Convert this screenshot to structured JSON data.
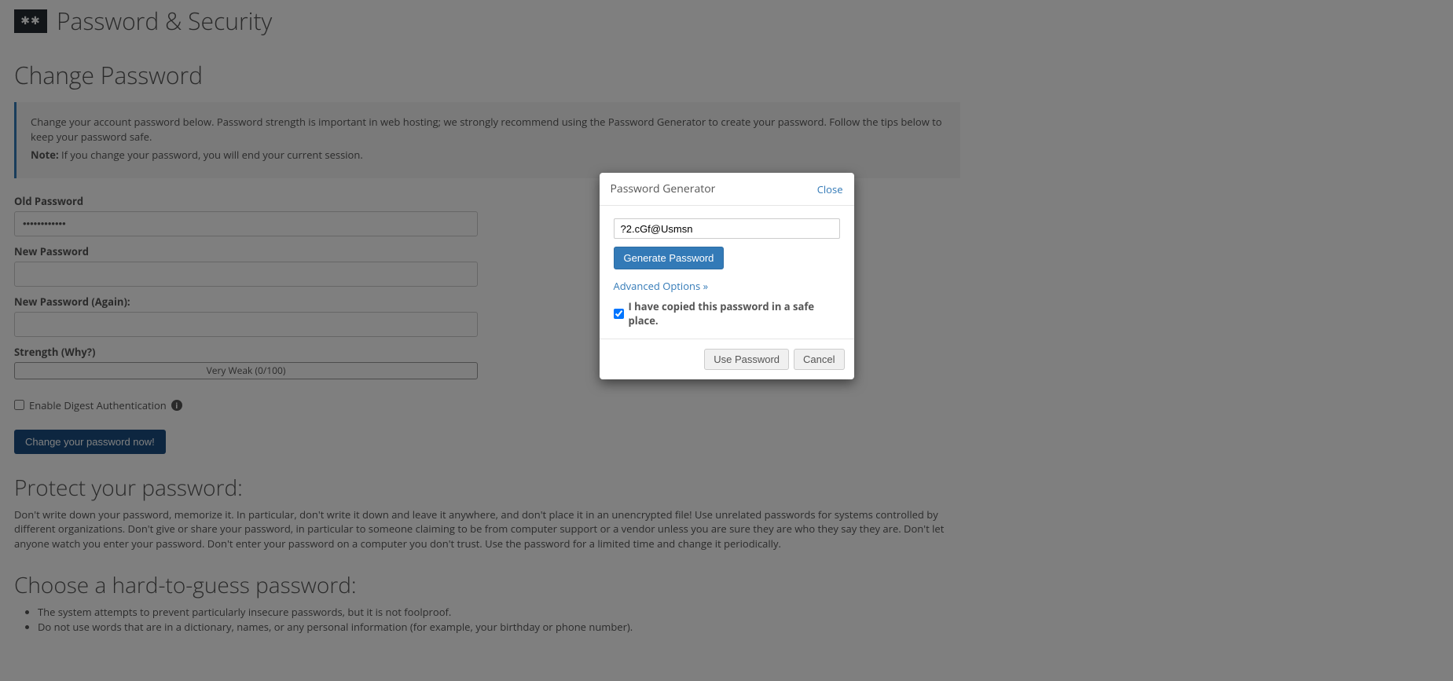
{
  "header": {
    "icon_glyph": "✱✱",
    "title": "Password & Security"
  },
  "change_password": {
    "heading": "Change Password",
    "info_text": "Change your account password below. Password strength is important in web hosting; we strongly recommend using the Password Generator to create your password. Follow the tips below to keep your password safe.",
    "note_label": "Note:",
    "note_text": " If you change your password, you will end your current session.",
    "fields": {
      "old_password_label": "Old Password",
      "old_password_value": "••••••••••••",
      "new_password_label": "New Password",
      "new_password_value": "",
      "new_password_again_label": "New Password (Again):",
      "new_password_again_value": "",
      "strength_label": "Strength (Why?)",
      "strength_text": "Very Weak (0/100)"
    },
    "digest_label": "Enable Digest Authentication",
    "submit_label": "Change your password now!"
  },
  "protect": {
    "heading": "Protect your password:",
    "text": "Don't write down your password, memorize it. In particular, don't write it down and leave it anywhere, and don't place it in an unencrypted file! Use unrelated passwords for systems controlled by different organizations. Don't give or share your password, in particular to someone claiming to be from computer support or a vendor unless you are sure they are who they say they are. Don't let anyone watch you enter your password. Don't enter your password on a computer you don't trust. Use the password for a limited time and change it periodically."
  },
  "choose": {
    "heading": "Choose a hard-to-guess password:",
    "tips": [
      "The system attempts to prevent particularly insecure passwords, but it is not foolproof.",
      "Do not use words that are in a dictionary, names, or any personal information (for example, your birthday or phone number)."
    ]
  },
  "modal": {
    "title": "Password Generator",
    "close_label": "Close",
    "generated_value": "?2.cGf@Usmsn",
    "generate_label": "Generate Password",
    "advanced_label": "Advanced Options »",
    "copied_label": "I have copied this password in a safe place.",
    "use_label": "Use Password",
    "cancel_label": "Cancel"
  }
}
